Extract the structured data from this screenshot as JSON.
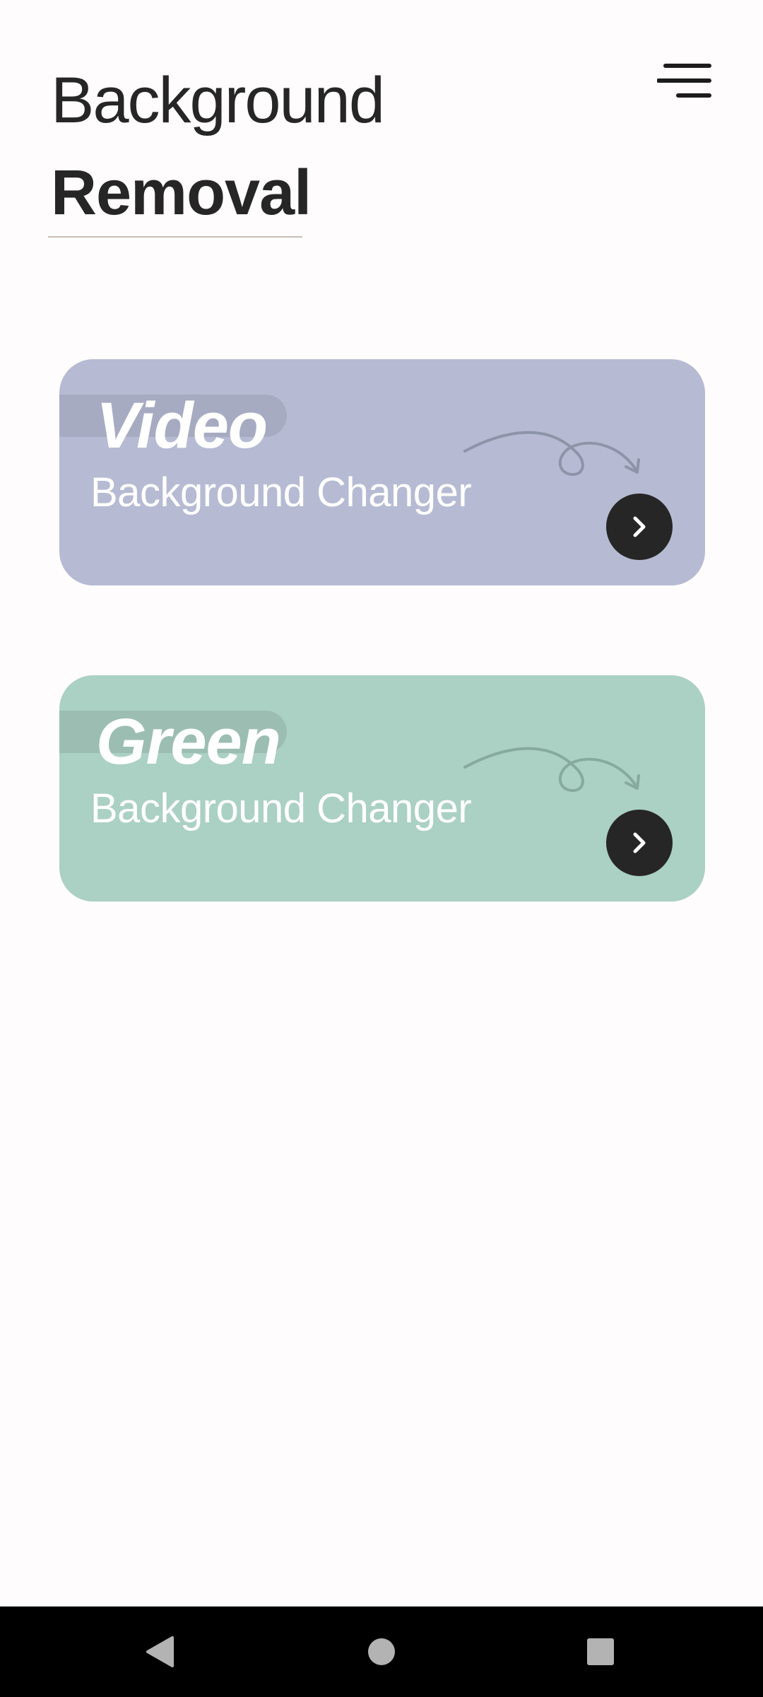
{
  "header": {
    "title_line1": "Background",
    "title_line2": "Removal",
    "menu_icon": "menu-icon"
  },
  "cards": [
    {
      "title": "Video",
      "subtitle": "Background Changer",
      "background_color": "#b6bbd3",
      "tab_color": "#a6abc2",
      "swirl_color": "#8e94a8",
      "action_icon": "chevron-right-icon"
    },
    {
      "title": "Green",
      "subtitle": "Background Changer",
      "background_color": "#abd0c4",
      "tab_color": "#9cbeb2",
      "swirl_color": "#87aa9e",
      "action_icon": "chevron-right-icon"
    }
  ],
  "nav_bar": {
    "back_icon": "back-triangle-icon",
    "home_icon": "home-circle-icon",
    "recents_icon": "recents-square-icon"
  },
  "colors": {
    "page_background": "#fefcfd",
    "text": "#262626",
    "button_dark": "#262626",
    "nav_bar": "#000000",
    "nav_icon": "#b3b3b3"
  }
}
